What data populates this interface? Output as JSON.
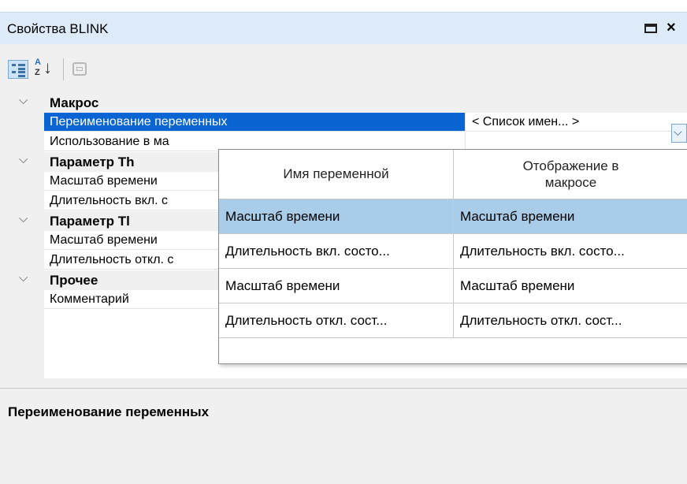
{
  "window": {
    "title": "Свойства BLINK"
  },
  "grid": {
    "categories": [
      "Макрос",
      "Параметр Th",
      "Параметр Tl",
      "Прочее"
    ],
    "properties": [
      "Переименование переменных",
      "Использование в ма",
      "Масштаб времени",
      "Длительность вкл. с",
      "Масштаб времени",
      "Длительность откл. с",
      "Комментарий"
    ],
    "selected_value": "< Список имен... >"
  },
  "popup": {
    "headers": [
      "Имя переменной",
      "Отображение в макросе"
    ],
    "rows": [
      {
        "name": "Масштаб времени",
        "display": "Масштаб времени"
      },
      {
        "name": "Длительность вкл. состо...",
        "display": "Длительность вкл. состо..."
      },
      {
        "name": "Масштаб времени",
        "display": "Масштаб времени"
      },
      {
        "name": "Длительность откл. сост...",
        "display": "Длительность откл. сост..."
      }
    ]
  },
  "description": {
    "title": "Переименование переменных"
  }
}
